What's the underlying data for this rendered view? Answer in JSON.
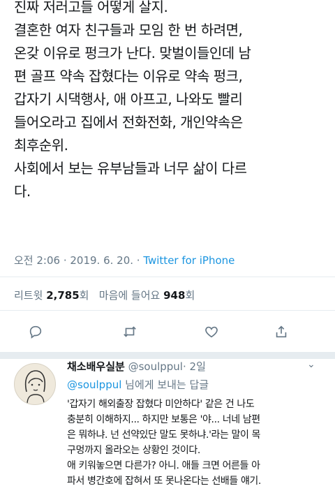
{
  "tweet": {
    "lines": [
      "진짜 저러고들 어떻게 살지.",
      "결혼한 여자 친구들과 모임 한 번 하려면,",
      "온갖 이유로 펑크가 난다. 맞벌이들인데 남",
      "편 골프 약속 잡혔다는 이유로 약속 펑크,",
      "갑자기 시댁행사, 애 아프고, 나와도 빨리",
      "들어오라고 집에서 전화전화, 개인약속은",
      "최후순위.",
      "사회에서 보는 유부남들과 너무 삶이 다르",
      "다."
    ],
    "timestamp": "오전 2:06 · 2019. 6. 20. · ",
    "source": "Twitter for iPhone"
  },
  "stats": {
    "retweet_label": "리트윗",
    "retweet_count": "2,785",
    "retweet_unit": "회",
    "like_label": "마음에 들어요",
    "like_count": "948",
    "like_unit": "회"
  },
  "actions": [
    "reply-icon",
    "retweet-icon",
    "like-icon",
    "share-icon"
  ],
  "reply": {
    "name": "채소배우실분",
    "handle": "@soulppul",
    "time": "· 2일",
    "replying_to": "@soulppul",
    "replying_suffix": " 님에게 보내는 답글",
    "lines": [
      "'갑자기 해외출장 잡혔다 미안하다' 같은 건 나도",
      "충분히 이해하지... 하지만 보통은 '야... 너네 남편",
      "은 뭐하냐. 넌 선약있단 말도 못하냐.'라는 말이 목",
      "구멍까지 올라오는 상황인 것이다.",
      "애 키워놓으면 다른가? 아니. 애들 크면 어른들 아",
      "파서 병간호에 잡혀서 또 못나온다는 선배들 얘기."
    ]
  },
  "colors": {
    "text": "#14171a",
    "muted": "#657786",
    "link": "#1b95e0",
    "divider": "#e6ecf0"
  }
}
